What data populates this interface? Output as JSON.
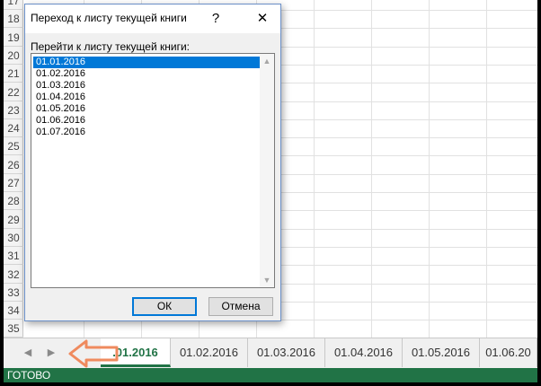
{
  "rows": [
    "17",
    "18",
    "19",
    "20",
    "21",
    "22",
    "23",
    "24",
    "25",
    "26",
    "27",
    "28",
    "29",
    "30",
    "31",
    "32",
    "33",
    "34",
    "35"
  ],
  "dialog": {
    "title": "Переход к листу текущей книги",
    "help_label": "?",
    "close_label": "✕",
    "list_label": "Перейти к листу текущей книги:",
    "sheets": [
      "01.01.2016",
      "01.02.2016",
      "01.03.2016",
      "01.04.2016",
      "01.05.2016",
      "01.06.2016",
      "01.07.2016"
    ],
    "selected_index": 0,
    "ok_label": "ОК",
    "cancel_label": "Отмена"
  },
  "tabbar": {
    "prev_icon": "◀",
    "next_icon": "▶",
    "tabs": [
      {
        "label": ".01.2016",
        "active": true
      },
      {
        "label": "01.02.2016",
        "active": false
      },
      {
        "label": "01.03.2016",
        "active": false
      },
      {
        "label": "01.04.2016",
        "active": false
      },
      {
        "label": "01.05.2016",
        "active": false
      },
      {
        "label": "01.06.20",
        "active": false
      }
    ]
  },
  "status": {
    "text": "ГОТОВО"
  },
  "colors": {
    "accent": "#217346",
    "selection": "#0078d7",
    "annotation_arrow": "#ef8a5e"
  }
}
